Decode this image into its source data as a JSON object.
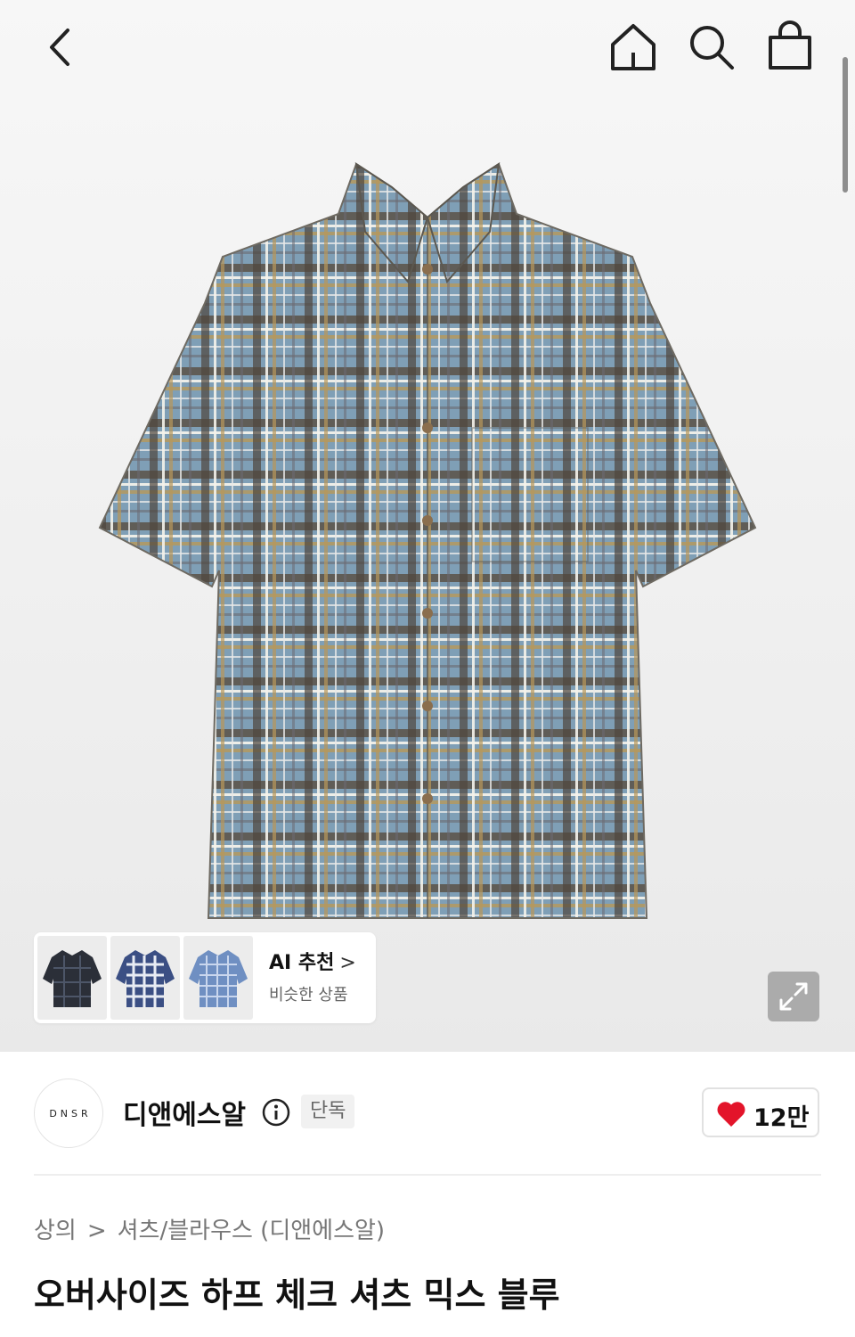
{
  "nav": {
    "back_icon": "chevron-left-icon",
    "home_icon": "home-icon",
    "search_icon": "search-icon",
    "bag_icon": "shopping-bag-icon"
  },
  "ai_recommend": {
    "title": "AI 추천",
    "arrow": ">",
    "subtitle": "비슷한 상품"
  },
  "brand": {
    "logo_text": "DNSR",
    "name": "디앤에스알",
    "badge": "단독",
    "like_count": "12만"
  },
  "breadcrumb": {
    "level1": "상의",
    "separator": ">",
    "level2": "셔츠/블라우스 (디앤에스알)"
  },
  "product": {
    "title": "오버사이즈 하프 체크 셔츠 믹스 블루"
  },
  "colors": {
    "heart": "#e3142a",
    "shirt_base": "#7f9fb6"
  }
}
